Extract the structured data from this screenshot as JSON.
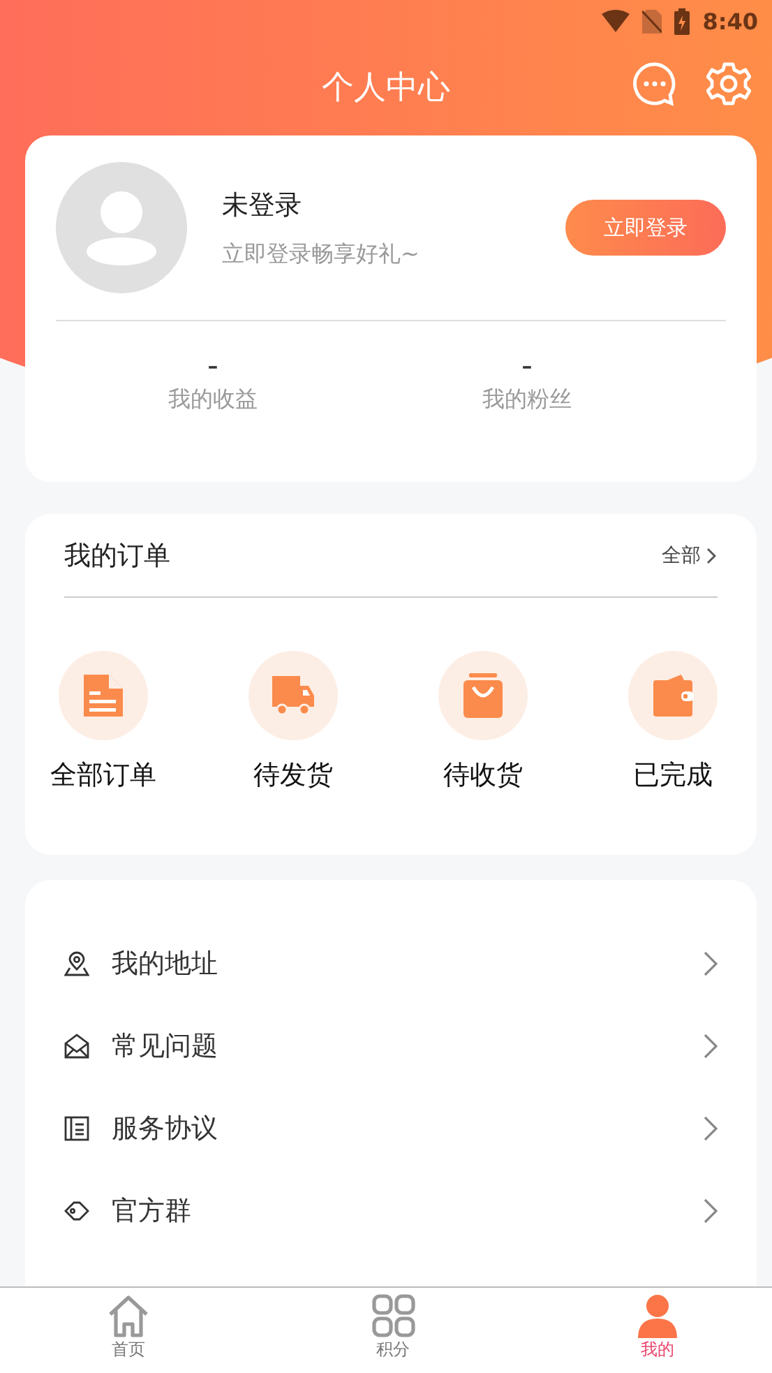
{
  "status_bar": {
    "time": "8:40"
  },
  "header": {
    "title": "个人中心"
  },
  "profile": {
    "name": "未登录",
    "subtitle": "立即登录畅享好礼~",
    "login_button": "立即登录",
    "stats": [
      {
        "value": "-",
        "label": "我的收益"
      },
      {
        "value": "-",
        "label": "我的粉丝"
      }
    ]
  },
  "orders": {
    "title": "我的订单",
    "more": "全部",
    "items": [
      {
        "label": "全部订单"
      },
      {
        "label": "待发货"
      },
      {
        "label": "待收货"
      },
      {
        "label": "已完成"
      }
    ]
  },
  "menu": [
    {
      "label": "我的地址"
    },
    {
      "label": "常见问题"
    },
    {
      "label": "服务协议"
    },
    {
      "label": "官方群"
    }
  ],
  "tabs": [
    {
      "label": "首页",
      "selected": false
    },
    {
      "label": "积分",
      "selected": false
    },
    {
      "label": "我的",
      "selected": true
    }
  ]
}
